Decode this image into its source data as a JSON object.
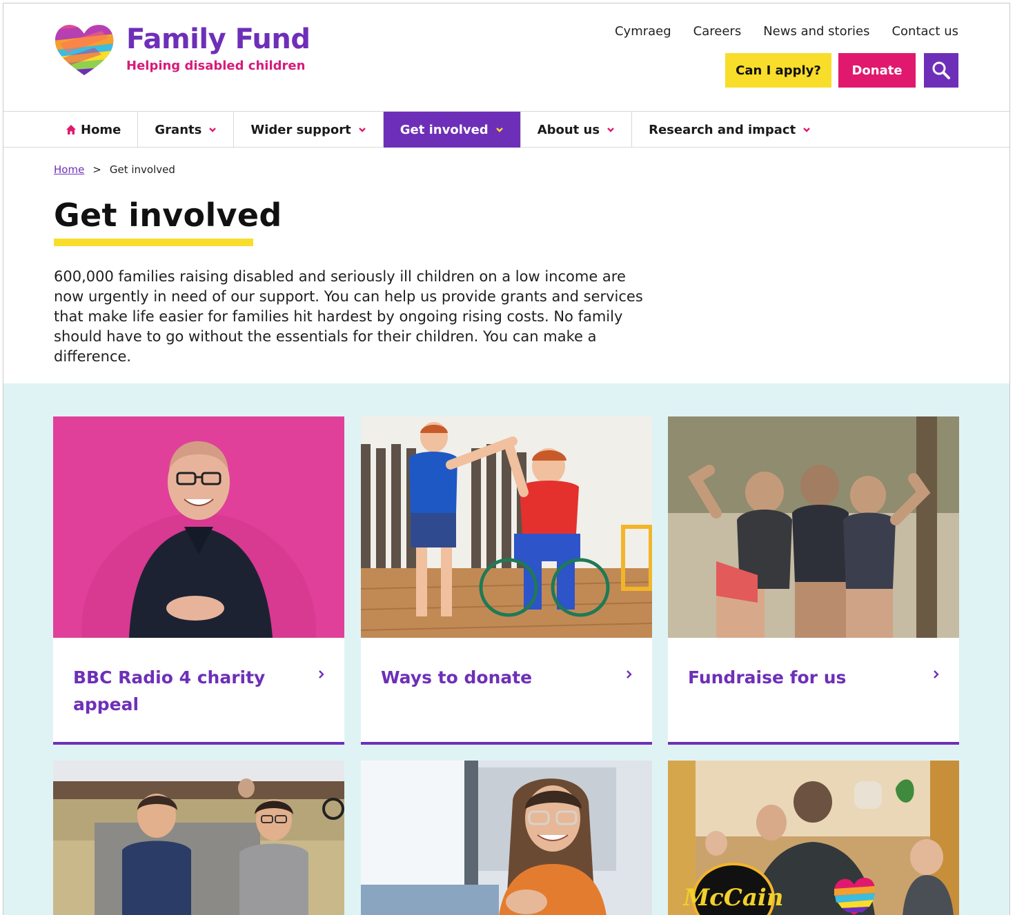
{
  "brand": {
    "name": "Family Fund",
    "tagline": "Helping disabled children",
    "colors": {
      "purple": "#6e2fb8",
      "pink": "#e0196e",
      "yellow": "#f9dd2b",
      "band": "#dff3f5"
    }
  },
  "toplinks": [
    "Cymraeg",
    "Careers",
    "News and stories",
    "Contact us"
  ],
  "actions": {
    "apply": "Can I apply?",
    "donate": "Donate",
    "search_icon": "search-icon"
  },
  "nav": {
    "items": [
      {
        "label": "Home",
        "icon": "home-icon"
      },
      {
        "label": "Grants"
      },
      {
        "label": "Wider support"
      },
      {
        "label": "Get involved",
        "active": true
      },
      {
        "label": "About us"
      },
      {
        "label": "Research and impact"
      }
    ]
  },
  "breadcrumb": {
    "home": "Home",
    "sep": ">",
    "current": "Get involved"
  },
  "page": {
    "title": "Get involved",
    "intro": "600,000 families raising disabled and seriously ill children on a low income are now urgently in need of our support. You can help us provide grants and services that make life easier for families hit hardest by ongoing rising costs. No family should have to go without the essentials for their children. You can make a difference."
  },
  "cards": [
    {
      "title": "BBC Radio 4 charity appeal"
    },
    {
      "title": "Ways to donate"
    },
    {
      "title": "Fundraise for us"
    }
  ],
  "bottom_cards": [
    {
      "image": "two boys sitting outdoors"
    },
    {
      "image": "smiling woman with glasses"
    },
    {
      "image": "family at table with McCain logo",
      "logo_text": "McCain"
    }
  ]
}
